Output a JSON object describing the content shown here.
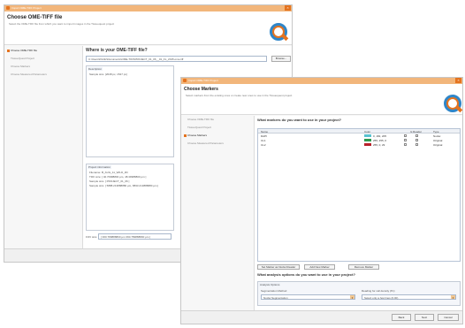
{
  "back_window": {
    "title": "Import OME-TIFF Project",
    "header_title": "Choose OME-TIFF file",
    "header_subtitle": "Select the OME-TIFF file from which you want to import images in the Tissuequest project",
    "nav_items": [
      {
        "label": "Choose OME-TIFF file",
        "active": true
      },
      {
        "label": "TissueQuest Project",
        "active": false
      },
      {
        "label": "Choose Markers",
        "active": false
      },
      {
        "label": "Choose Measured Parameters",
        "active": false
      }
    ],
    "question": "Where is your OME-TIFF file?",
    "file_path": "C:\\Users\\Public\\Documents\\OME-TIFF\\PROJECT_01_06__01_FL_2015.ome.tiff",
    "browse_label": "Browse...",
    "description_title": "Description",
    "description_text": "Sample size: [2048 px, 1547 px]",
    "details_title": "Project information",
    "details_lines": [
      "Filename: B_AUG_11_WILD_3D",
      "TIFF size: [ 40.70988800 µm, 48.39988800 µm ]",
      "Sample size: [ PROJECT_01_06 ]",
      "Sample size: [ 5888.213888880 µm, 8833.213888880 µm ]"
    ],
    "fov_label": "FOV size:",
    "fov_value": "[ 360.789888800 µm 360.789888800 µm ]"
  },
  "front_window": {
    "title": "Import OME-TIFF Project",
    "header_title": "Choose Markers",
    "header_subtitle": "Select markers from the existing ones or create new ones to use in the Tissuequest project",
    "nav_items": [
      {
        "label": "Choose OME-TIFF file",
        "active": false
      },
      {
        "label": "TissueQuest Project",
        "active": false
      },
      {
        "label": "Choose Markers",
        "active": true
      },
      {
        "label": "Choose Measured Parameters",
        "active": false
      }
    ],
    "question": "What markers do you want to use in your project?",
    "table": {
      "columns": [
        "Name",
        "Color",
        "Is Reader",
        "Type"
      ],
      "rows": [
        {
          "name": "DAPI",
          "color": "#58c2d0",
          "color_text": "0, 182, 205",
          "type": "Nuclei"
        },
        {
          "name": "CL1",
          "color": "#2e9a4e",
          "color_text": "255, 255, 0",
          "type": "Original"
        },
        {
          "name": "CL2",
          "color": "#b8202a",
          "color_text": "255, 0, 29",
          "type": "Original"
        }
      ]
    },
    "buttons": {
      "set_reader": "Set Marker as Nuclei Reader",
      "add_marker": "Add New Marker",
      "remove_marker": "Remove Marker"
    },
    "options_question": "What analysis options do you want to use in your project?",
    "options_group_title": "Analysis Options",
    "segmentation_label": "Segmentation Method",
    "segmentation_value": "Nuclei Segmentation",
    "pixel_label": "Reading for cell density (Px)",
    "pixel_value": "Select only a few lines (0.00)",
    "footer_buttons": {
      "back": "Back",
      "next": "Next",
      "cancel": "Cancel"
    }
  },
  "colors": {
    "accent": "#e4731f",
    "titlebar": "#f2b67b",
    "logo_blue": "#2f86c9"
  }
}
